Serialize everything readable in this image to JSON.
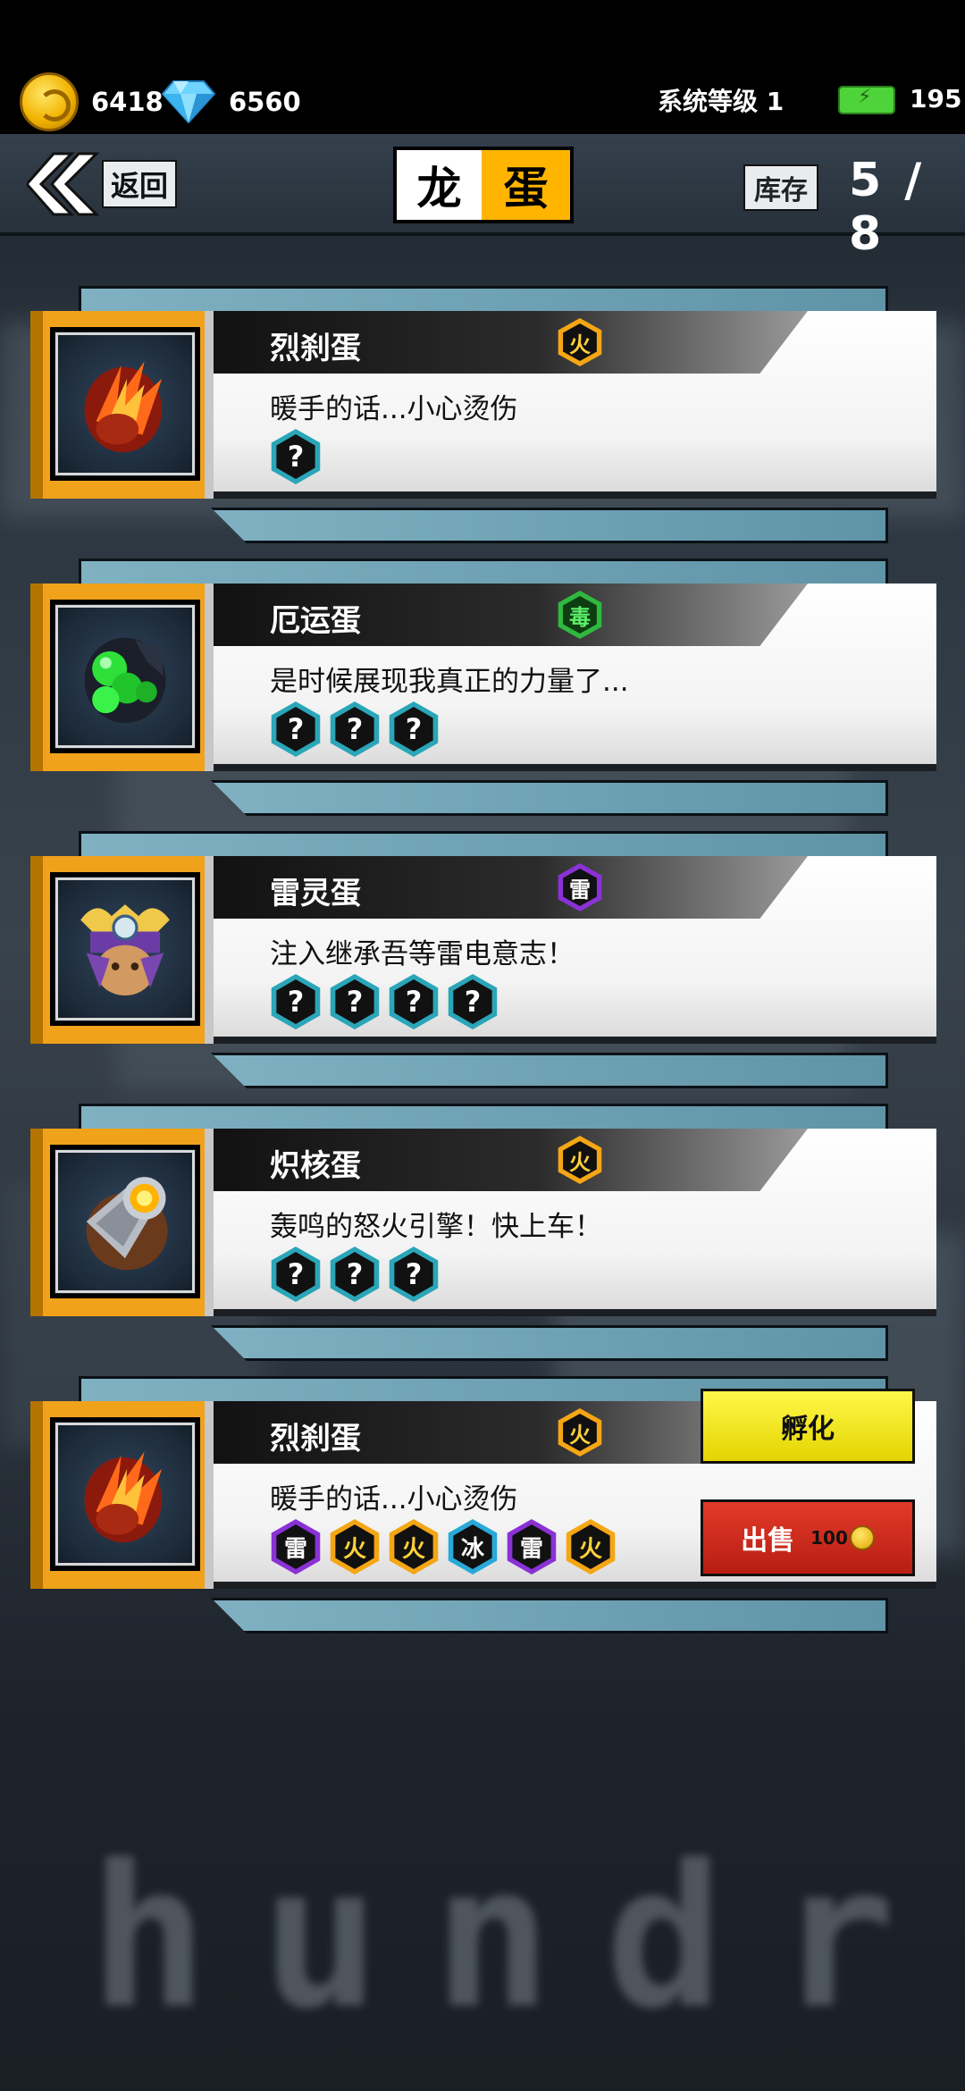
{
  "resources": {
    "coins": "6418",
    "gems": "6560",
    "system_level": "系统等级 1",
    "energy": "195"
  },
  "header": {
    "back_label": "返回",
    "title_part1": "龙",
    "title_part2": "蛋",
    "stock_label": "库存",
    "stock_value": "5 / 8"
  },
  "cards": [
    {
      "name": "烈刹蛋",
      "element": "火",
      "element_type": "fire",
      "desc": "暖手的话...小心烫伤",
      "egg": "fire-egg",
      "gems": [
        {
          "label": "?",
          "type": "unknown"
        }
      ]
    },
    {
      "name": "厄运蛋",
      "element": "毒",
      "element_type": "poison",
      "desc": "是时候展现我真正的力量了...",
      "egg": "poison-egg",
      "gems": [
        {
          "label": "?",
          "type": "unknown"
        },
        {
          "label": "?",
          "type": "unknown"
        },
        {
          "label": "?",
          "type": "unknown"
        }
      ]
    },
    {
      "name": "雷灵蛋",
      "element": "雷",
      "element_type": "thunder",
      "desc": "注入继承吾等雷电意志！",
      "egg": "thunder-egg",
      "gems": [
        {
          "label": "?",
          "type": "unknown"
        },
        {
          "label": "?",
          "type": "unknown"
        },
        {
          "label": "?",
          "type": "unknown"
        },
        {
          "label": "?",
          "type": "unknown"
        }
      ]
    },
    {
      "name": "炽核蛋",
      "element": "火",
      "element_type": "fire",
      "desc": "轰鸣的怒火引擎！快上车！",
      "egg": "core-egg",
      "gems": [
        {
          "label": "?",
          "type": "unknown"
        },
        {
          "label": "?",
          "type": "unknown"
        },
        {
          "label": "?",
          "type": "unknown"
        }
      ]
    },
    {
      "name": "烈刹蛋",
      "element": "火",
      "element_type": "fire",
      "desc": "暖手的话...小心烫伤",
      "egg": "fire-egg",
      "gems": [
        {
          "label": "雷",
          "type": "thunder"
        },
        {
          "label": "火",
          "type": "fire"
        },
        {
          "label": "火",
          "type": "fire"
        },
        {
          "label": "冰",
          "type": "ice"
        },
        {
          "label": "雷",
          "type": "thunder"
        },
        {
          "label": "火",
          "type": "fire"
        }
      ],
      "actions": {
        "hatch": "孵化",
        "sell": "出售",
        "sell_price": "100"
      }
    }
  ],
  "background_text": "hundr"
}
